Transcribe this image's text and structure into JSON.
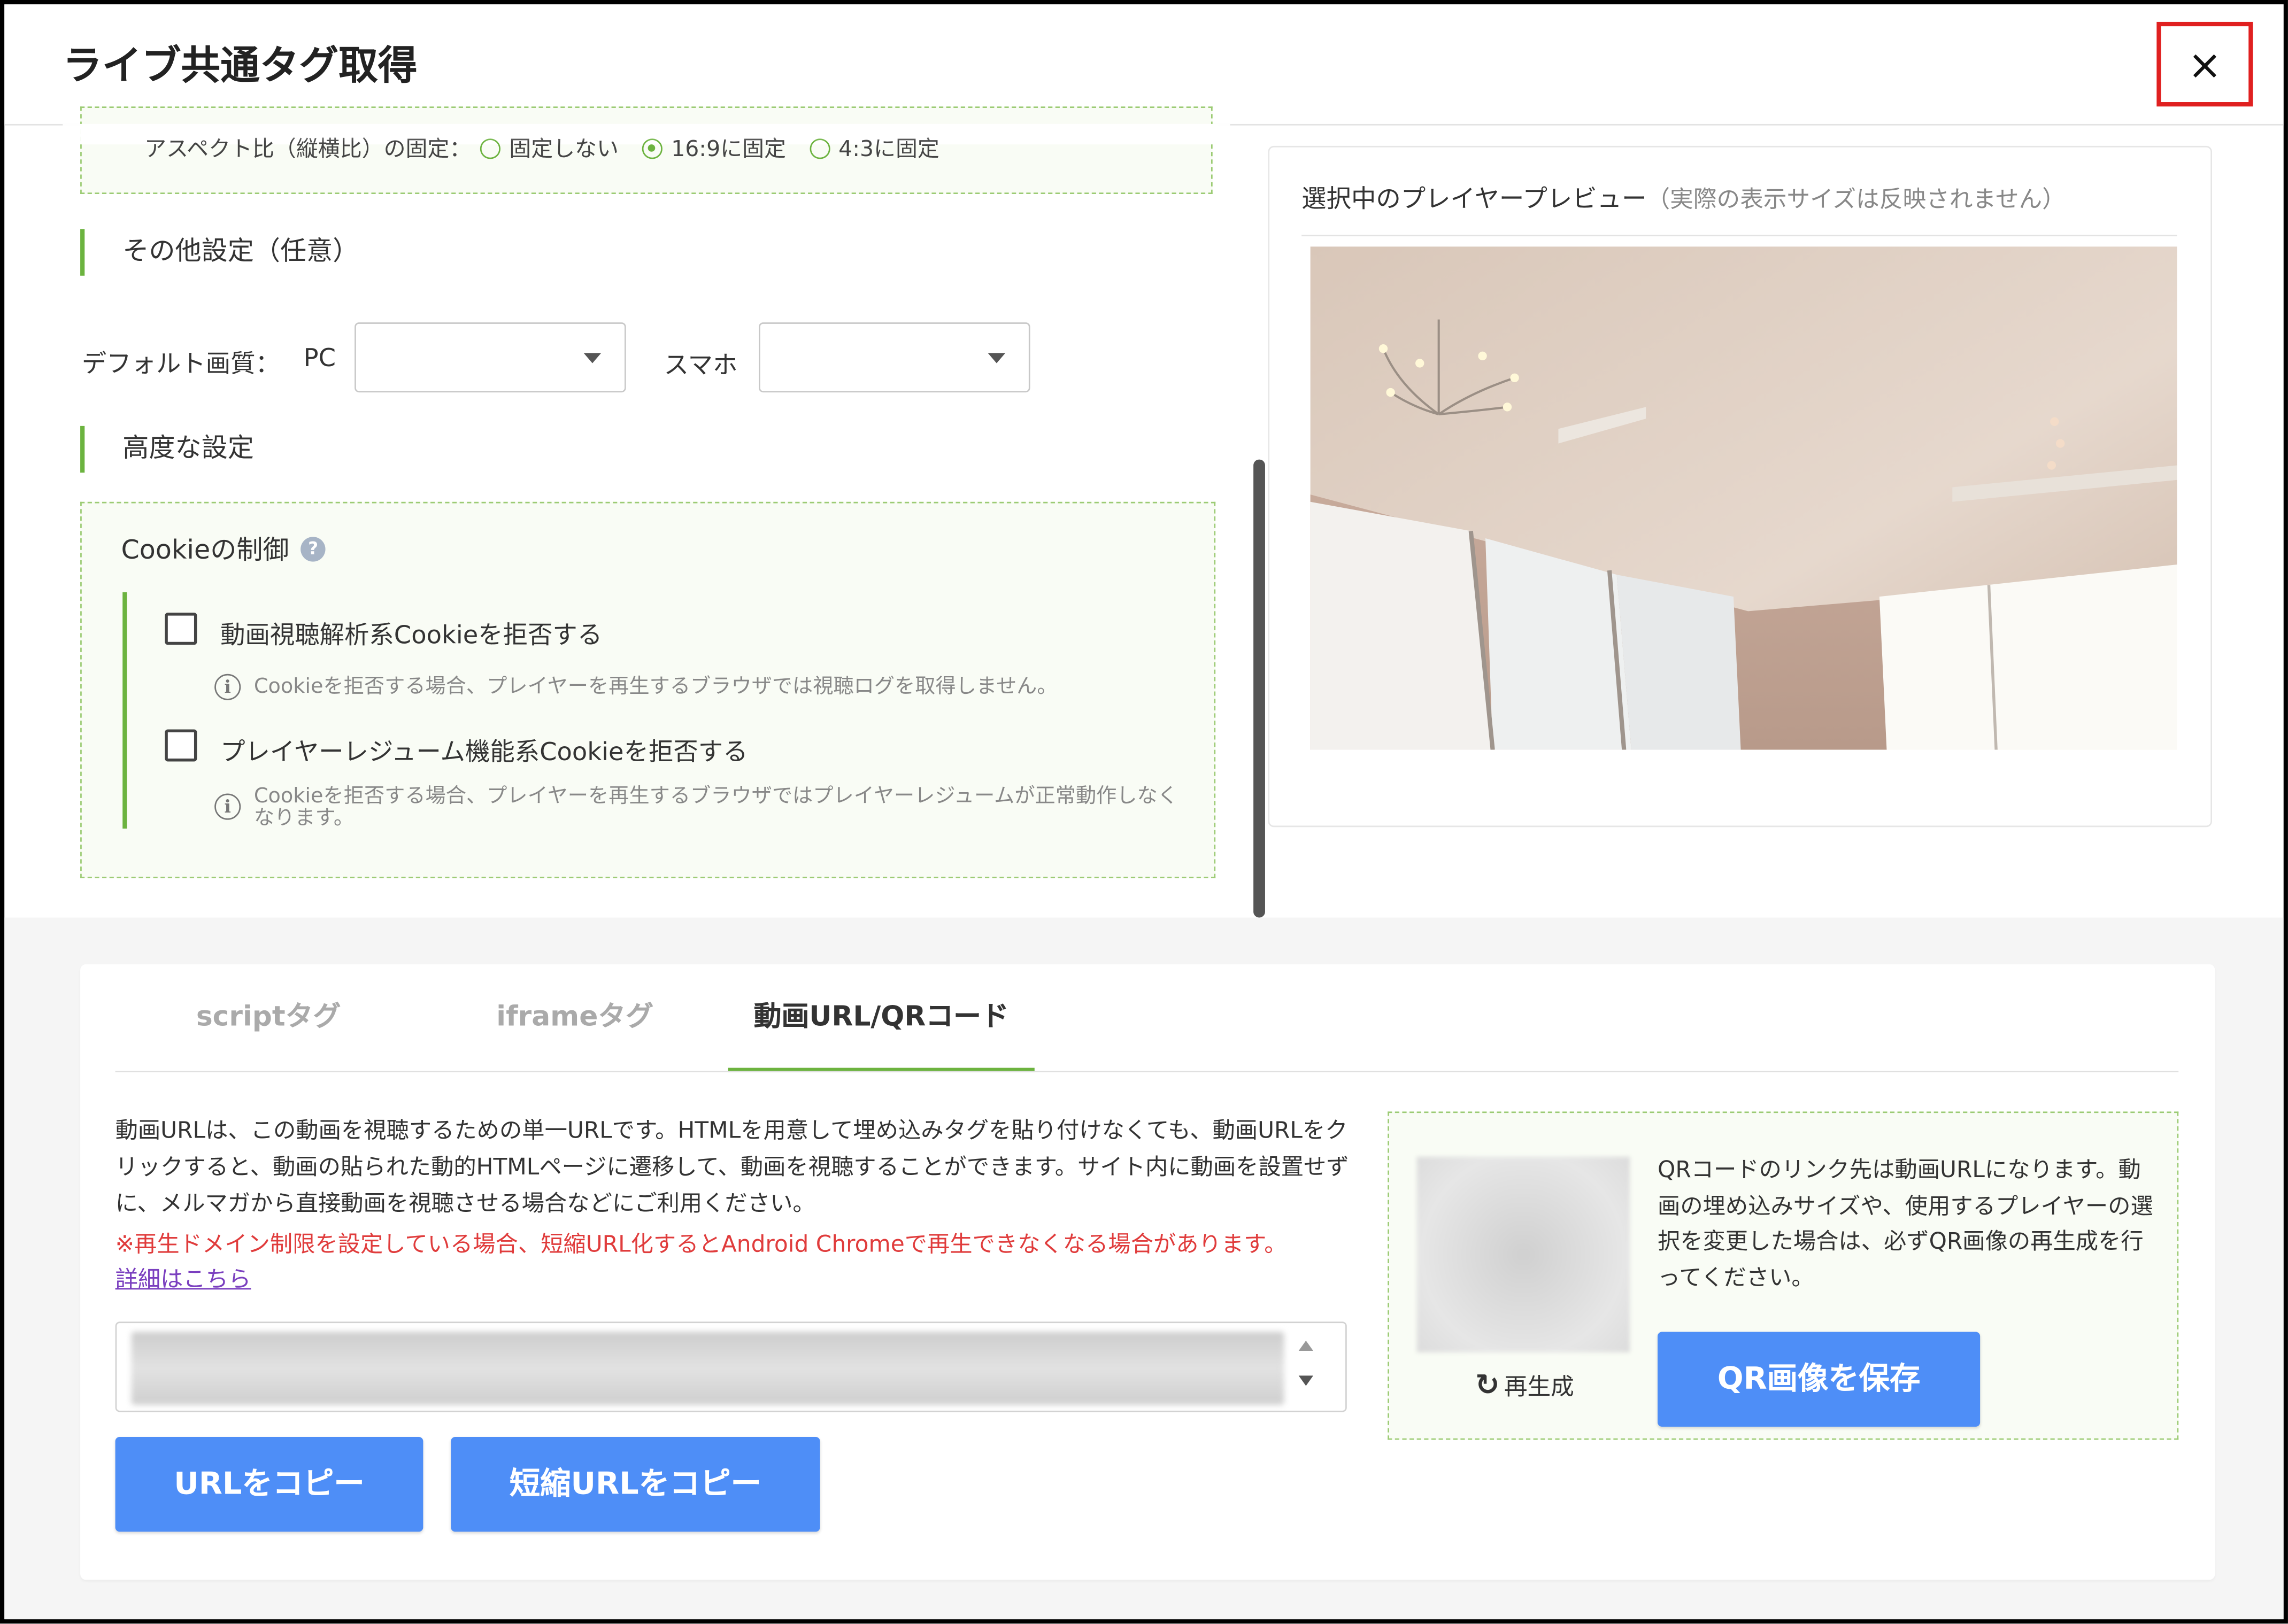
{
  "window": {
    "title": "ライブ共通タグ取得",
    "close_label": "×"
  },
  "aspect": {
    "label": "アスペクト比（縦横比）の固定：",
    "options": [
      "固定しない",
      "16:9に固定",
      "4:3に固定"
    ],
    "selected": "16:9に固定"
  },
  "other_settings": {
    "heading": "その他設定（任意）",
    "quality_label": "デフォルト画質：",
    "pc_label": "PC",
    "sp_label": "スマホ",
    "pc_value": "",
    "sp_value": ""
  },
  "advanced": {
    "heading": "高度な設定",
    "cookie_title": "Cookieの制御",
    "help_glyph": "?",
    "info_glyph": "i",
    "items": [
      {
        "label": "動画視聴解析系Cookieを拒否する",
        "checked": false,
        "note": "Cookieを拒否する場合、プレイヤーを再生するブラウザでは視聴ログを取得しません。"
      },
      {
        "label": "プレイヤーレジューム機能系Cookieを拒否する",
        "checked": false,
        "note": "Cookieを拒否する場合、プレイヤーを再生するブラウザではプレイヤーレジュームが正常動作しなくなります。"
      }
    ]
  },
  "preview": {
    "title": "選択中のプレイヤープレビュー",
    "subtitle": "（実際の表示サイズは反映されません）"
  },
  "tabs": [
    {
      "label": "scriptタグ",
      "active": false
    },
    {
      "label": "iframeタグ",
      "active": false
    },
    {
      "label": "動画URL/QRコード",
      "active": true
    }
  ],
  "url_panel": {
    "description": "動画URLは、この動画を視聴するための単一URLです。HTMLを用意して埋め込みタグを貼り付けなくても、動画URLをクリックすると、動画の貼られた動的HTMLページに遷移して、動画を視聴することができます。サイト内に動画を設置せずに、メルマガから直接動画を視聴させる場合などにご利用ください。",
    "warning": "※再生ドメイン制限を設定している場合、短縮URL化するとAndroid Chromeで再生できなくなる場合があります。",
    "detail_link": "詳細はこちら",
    "copy_url_button": "URLをコピー",
    "copy_short_url_button": "短縮URLをコピー"
  },
  "qr_panel": {
    "regen_label": "再生成",
    "regen_glyph": "↻",
    "description": "QRコードのリンク先は動画URLになります。動画の埋め込みサイズや、使用するプレイヤーの選択を変更した場合は、必ずQR画像の再生成を行ってください。",
    "save_button": "QR画像を保存"
  },
  "colors": {
    "accent_green": "#6cb33f",
    "button_blue": "#4e8ef7",
    "warning_red": "#e03c3c",
    "close_highlight": "#e02020"
  },
  "icons": [
    "close-icon",
    "help-icon",
    "info-icon",
    "caret-down-icon",
    "refresh-icon"
  ]
}
